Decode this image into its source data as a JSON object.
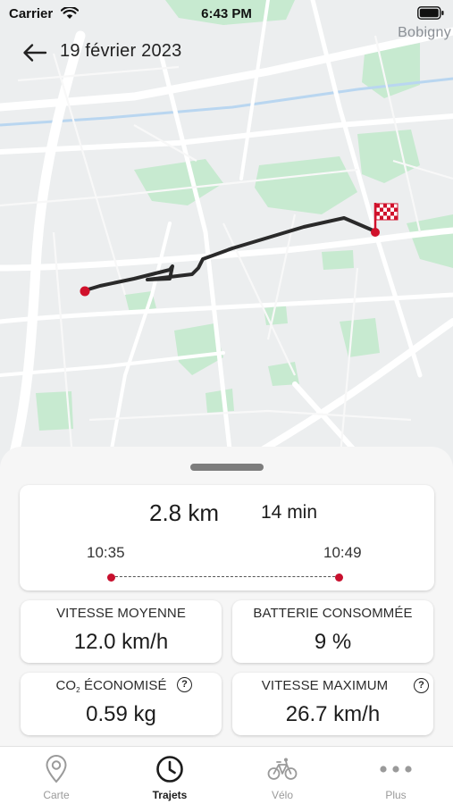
{
  "status_bar": {
    "carrier": "Carrier",
    "time": "6:43 PM"
  },
  "header": {
    "title": "19 février 2023",
    "back_icon": "arrow-left-icon"
  },
  "map": {
    "place_label": "Bobigny",
    "route_color": "#2a2a2a",
    "marker_color": "#d0112b"
  },
  "summary": {
    "distance": "2.8 km",
    "duration": "14 min",
    "start_time": "10:35",
    "end_time": "10:49"
  },
  "stats": [
    {
      "title": "VITESSE MOYENNE",
      "value": "12.0 km/h"
    },
    {
      "title": "BATTERIE CONSOMMÉE",
      "value": "9 %"
    },
    {
      "title_prefix": "CO",
      "title_sub": "2",
      "title_rest": " ÉCONOMISÉ",
      "value": "0.59 kg",
      "help_icon": "?"
    },
    {
      "title": "VITESSE MAXIMUM",
      "value": "26.7 km/h",
      "help_icon": "?"
    }
  ],
  "tabs": [
    {
      "label": "Carte",
      "icon": "map-pin-icon"
    },
    {
      "label": "Trajets",
      "icon": "clock-icon",
      "active": true
    },
    {
      "label": "Vélo",
      "icon": "bike-icon"
    },
    {
      "label": "Plus",
      "icon": "more-dots-icon"
    }
  ],
  "colors": {
    "accent": "#c8102e",
    "sheet_bg": "#f6f6f6",
    "map_bg": "#eceeef",
    "park_green": "#bfe6c9"
  }
}
